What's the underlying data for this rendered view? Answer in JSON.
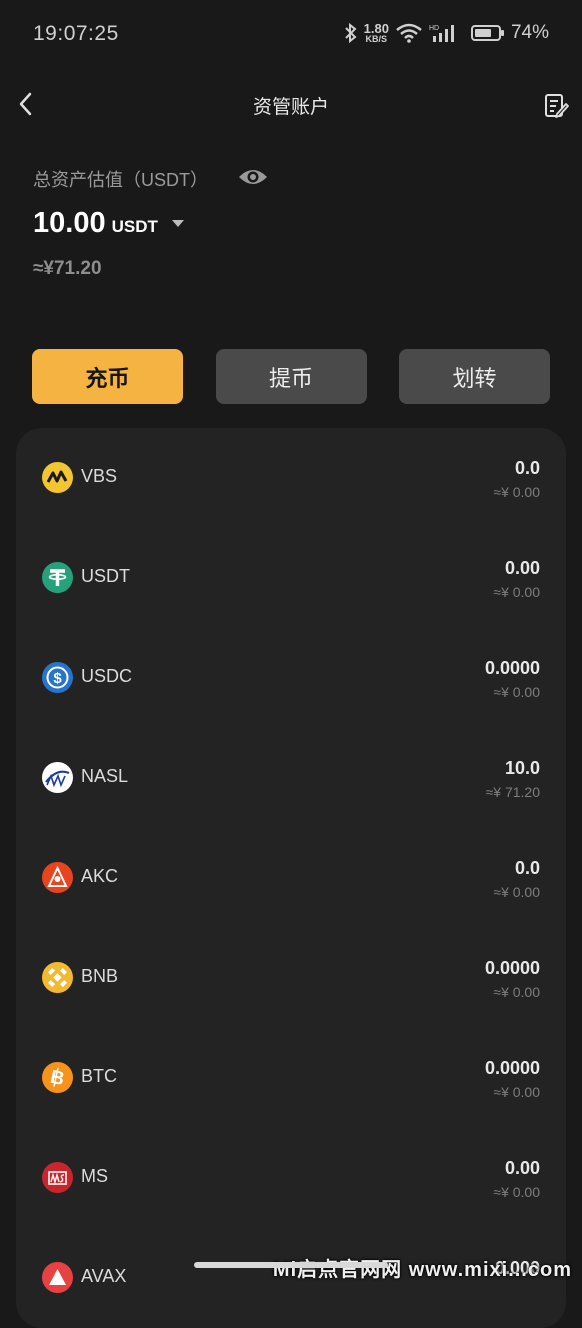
{
  "status_bar": {
    "time": "19:07:25",
    "net_speed_value": "1.80",
    "net_speed_unit": "KB/S",
    "battery_text": "74%",
    "battery_level": 0.74
  },
  "header": {
    "title": "资管账户",
    "back_icon": "chevron-left-icon",
    "records_icon": "document-edit-icon"
  },
  "summary": {
    "label": "总资产估值（USDT）",
    "total_value": "10.00",
    "total_unit": "USDT",
    "cny_value": "≈¥71.20"
  },
  "actions": {
    "deposit": "充币",
    "withdraw": "提币",
    "transfer": "划转"
  },
  "coins": [
    {
      "name": "VBS",
      "amount": "0.0",
      "cny": "≈¥ 0.00",
      "color": "#f2c531"
    },
    {
      "name": "USDT",
      "amount": "0.00",
      "cny": "≈¥ 0.00",
      "color": "#26a17b"
    },
    {
      "name": "USDC",
      "amount": "0.0000",
      "cny": "≈¥ 0.00",
      "color": "#2775ca"
    },
    {
      "name": "NASL",
      "amount": "10.0",
      "cny": "≈¥ 71.20",
      "color": "#ffffff"
    },
    {
      "name": "AKC",
      "amount": "0.0",
      "cny": "≈¥ 0.00",
      "color": "#e8451e"
    },
    {
      "name": "BNB",
      "amount": "0.0000",
      "cny": "≈¥ 0.00",
      "color": "#f3ba2f"
    },
    {
      "name": "BTC",
      "amount": "0.0000",
      "cny": "≈¥ 0.00",
      "color": "#f7931a"
    },
    {
      "name": "MS",
      "amount": "0.00",
      "cny": "≈¥ 0.00",
      "color": "#c8262c"
    },
    {
      "name": "AVAX",
      "amount": "0.000",
      "cny": "",
      "color": "#e84142"
    }
  ],
  "watermark": "Mi启点官网网 www.mixi...com"
}
